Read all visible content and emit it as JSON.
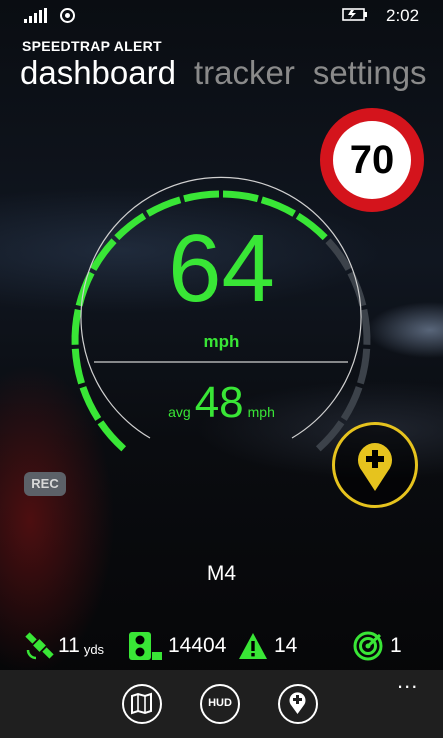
{
  "status_bar": {
    "time": "2:02"
  },
  "app": {
    "title": "SPEEDTRAP ALERT"
  },
  "pivot": {
    "tabs": [
      "dashboard",
      "tracker",
      "settings"
    ],
    "active": "dashboard"
  },
  "speed_limit": {
    "value": "70"
  },
  "speedometer": {
    "speed": "64",
    "unit": "mph",
    "avg_label": "avg",
    "avg_speed": "48",
    "avg_unit": "mph"
  },
  "rec_label": "REC",
  "road": "M4",
  "stats": {
    "gps_accuracy": "11",
    "gps_unit": "yds",
    "cameras": "14404",
    "alerts": "14",
    "radar": "1"
  },
  "appbar": {
    "hud_label": "HUD",
    "more": "..."
  },
  "colors": {
    "accent_green": "#39e636",
    "limit_red": "#d4141c",
    "poi_yellow": "#e6c31e"
  }
}
